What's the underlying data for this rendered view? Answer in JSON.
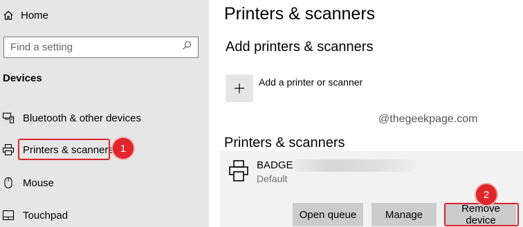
{
  "sidebar": {
    "home_label": "Home",
    "search_placeholder": "Find a setting",
    "section_title": "Devices",
    "items": [
      {
        "label": "Bluetooth & other devices",
        "icon": "bluetooth-devices-icon"
      },
      {
        "label": "Printers & scanners",
        "icon": "printer-icon"
      },
      {
        "label": "Mouse",
        "icon": "mouse-icon"
      },
      {
        "label": "Touchpad",
        "icon": "touchpad-icon"
      }
    ]
  },
  "main": {
    "title": "Printers & scanners",
    "add_section_title": "Add printers & scanners",
    "add_button_label": "Add a printer or scanner",
    "list_title": "Printers & scanners",
    "device": {
      "name": "BADGE",
      "status": "Default"
    },
    "buttons": {
      "open_queue": "Open queue",
      "manage": "Manage",
      "remove_device": "Remove device"
    }
  },
  "annotations": {
    "watermark": "@thegeekpage.com",
    "step_1": "1",
    "step_2": "2"
  },
  "colors": {
    "sidebar_bg": "#e6e6e6",
    "button_bg": "#cccccc",
    "device_panel_bg": "#f2f2f2",
    "annotation_red": "#e0262a"
  }
}
